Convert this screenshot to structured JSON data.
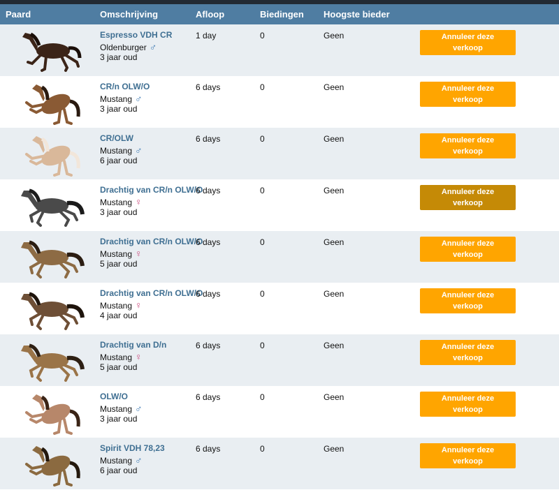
{
  "columns": {
    "horse": "Paard",
    "desc": "Omschrijving",
    "expiry": "Afloop",
    "bids": "Biedingen",
    "highest": "Hoogste bieder"
  },
  "colors": {
    "header": "#4f7da2",
    "button": "#ffa500",
    "button_hover": "#c58a06",
    "link": "#3f6f92",
    "male": "#3f7bb3",
    "female": "#cc4d7f",
    "row_alt": "#e9eef2"
  },
  "rows": [
    {
      "name": "Espresso VDH CR",
      "breed": "Oldenburger",
      "gender": "male",
      "gender_symbol": "♂",
      "age": "3 jaar oud",
      "expiry": "1 day",
      "bids": "0",
      "highest": "Geen",
      "button": "Annuleer deze verkoop",
      "coat": "#3b2418",
      "mane": "#1a0e08",
      "pose": "trot"
    },
    {
      "name": "CR/n OLW/O",
      "breed": "Mustang",
      "gender": "male",
      "gender_symbol": "♂",
      "age": "3 jaar oud",
      "expiry": "6 days",
      "bids": "0",
      "highest": "Geen",
      "button": "Annuleer deze verkoop",
      "coat": "#8a5a34",
      "mane": "#2a1a10",
      "pose": "rear"
    },
    {
      "name": "CR/OLW",
      "breed": "Mustang",
      "gender": "male",
      "gender_symbol": "♂",
      "age": "6 jaar oud",
      "expiry": "6 days",
      "bids": "0",
      "highest": "Geen",
      "button": "Annuleer deze verkoop",
      "coat": "#d9b89a",
      "mane": "#f2e6da",
      "pose": "rear"
    },
    {
      "name": "Drachtig van CR/n OLW/O",
      "breed": "Mustang",
      "gender": "female",
      "gender_symbol": "♀",
      "age": "3 jaar oud",
      "expiry": "6 days",
      "bids": "0",
      "highest": "Geen",
      "button": "Annuleer deze verkoop",
      "hover": true,
      "coat": "#4a4a4a",
      "mane": "#1b1b1b",
      "pose": "gallop"
    },
    {
      "name": "Drachtig van CR/n OLW/O",
      "breed": "Mustang",
      "gender": "female",
      "gender_symbol": "♀",
      "age": "5 jaar oud",
      "expiry": "6 days",
      "bids": "0",
      "highest": "Geen",
      "button": "Annuleer deze verkoop",
      "coat": "#8d6b44",
      "mane": "#2b1d12",
      "pose": "gallop"
    },
    {
      "name": "Drachtig van CR/n OLW/O",
      "breed": "Mustang",
      "gender": "female",
      "gender_symbol": "♀",
      "age": "4 jaar oud",
      "expiry": "6 days",
      "bids": "0",
      "highest": "Geen",
      "button": "Annuleer deze verkoop",
      "coat": "#6e4f36",
      "mane": "#1e140c",
      "pose": "gallop"
    },
    {
      "name": "Drachtig van D/n",
      "breed": "Mustang",
      "gender": "female",
      "gender_symbol": "♀",
      "age": "5 jaar oud",
      "expiry": "6 days",
      "bids": "0",
      "highest": "Geen",
      "button": "Annuleer deze verkoop",
      "coat": "#9a7448",
      "mane": "#2d1f13",
      "pose": "gallop"
    },
    {
      "name": "OLW/O",
      "breed": "Mustang",
      "gender": "male",
      "gender_symbol": "♂",
      "age": "3 jaar oud",
      "expiry": "6 days",
      "bids": "0",
      "highest": "Geen",
      "button": "Annuleer deze verkoop",
      "coat": "#b7876a",
      "mane": "#3a2416",
      "pose": "rear"
    },
    {
      "name": "Spirit VDH 78,23",
      "breed": "Mustang",
      "gender": "male",
      "gender_symbol": "♂",
      "age": "6 jaar oud",
      "expiry": "6 days",
      "bids": "0",
      "highest": "Geen",
      "button": "Annuleer deze verkoop",
      "coat": "#8b6a40",
      "mane": "#23180d",
      "pose": "rear"
    }
  ]
}
